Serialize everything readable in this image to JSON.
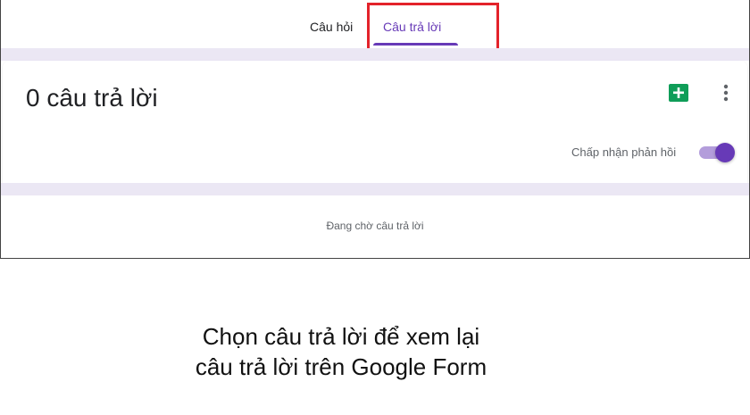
{
  "tabs": {
    "questions_label": "Câu hỏi",
    "responses_label": "Câu trả lời"
  },
  "responses": {
    "count_heading": "0 câu trả lời",
    "accepting_label": "Chấp nhận phản hồi",
    "accepting_enabled": true,
    "waiting_text": "Đang chờ câu trả lời"
  },
  "icons": {
    "sheets": "google-sheets-icon",
    "more": "more-vert-icon"
  },
  "colors": {
    "accent": "#673ab7",
    "highlight": "#e3222a",
    "sheets_green": "#0f9d58",
    "band": "#ebe7f4"
  },
  "caption": {
    "line1": "Chọn câu trả lời để xem lại",
    "line2": "câu trả lời trên Google Form"
  }
}
